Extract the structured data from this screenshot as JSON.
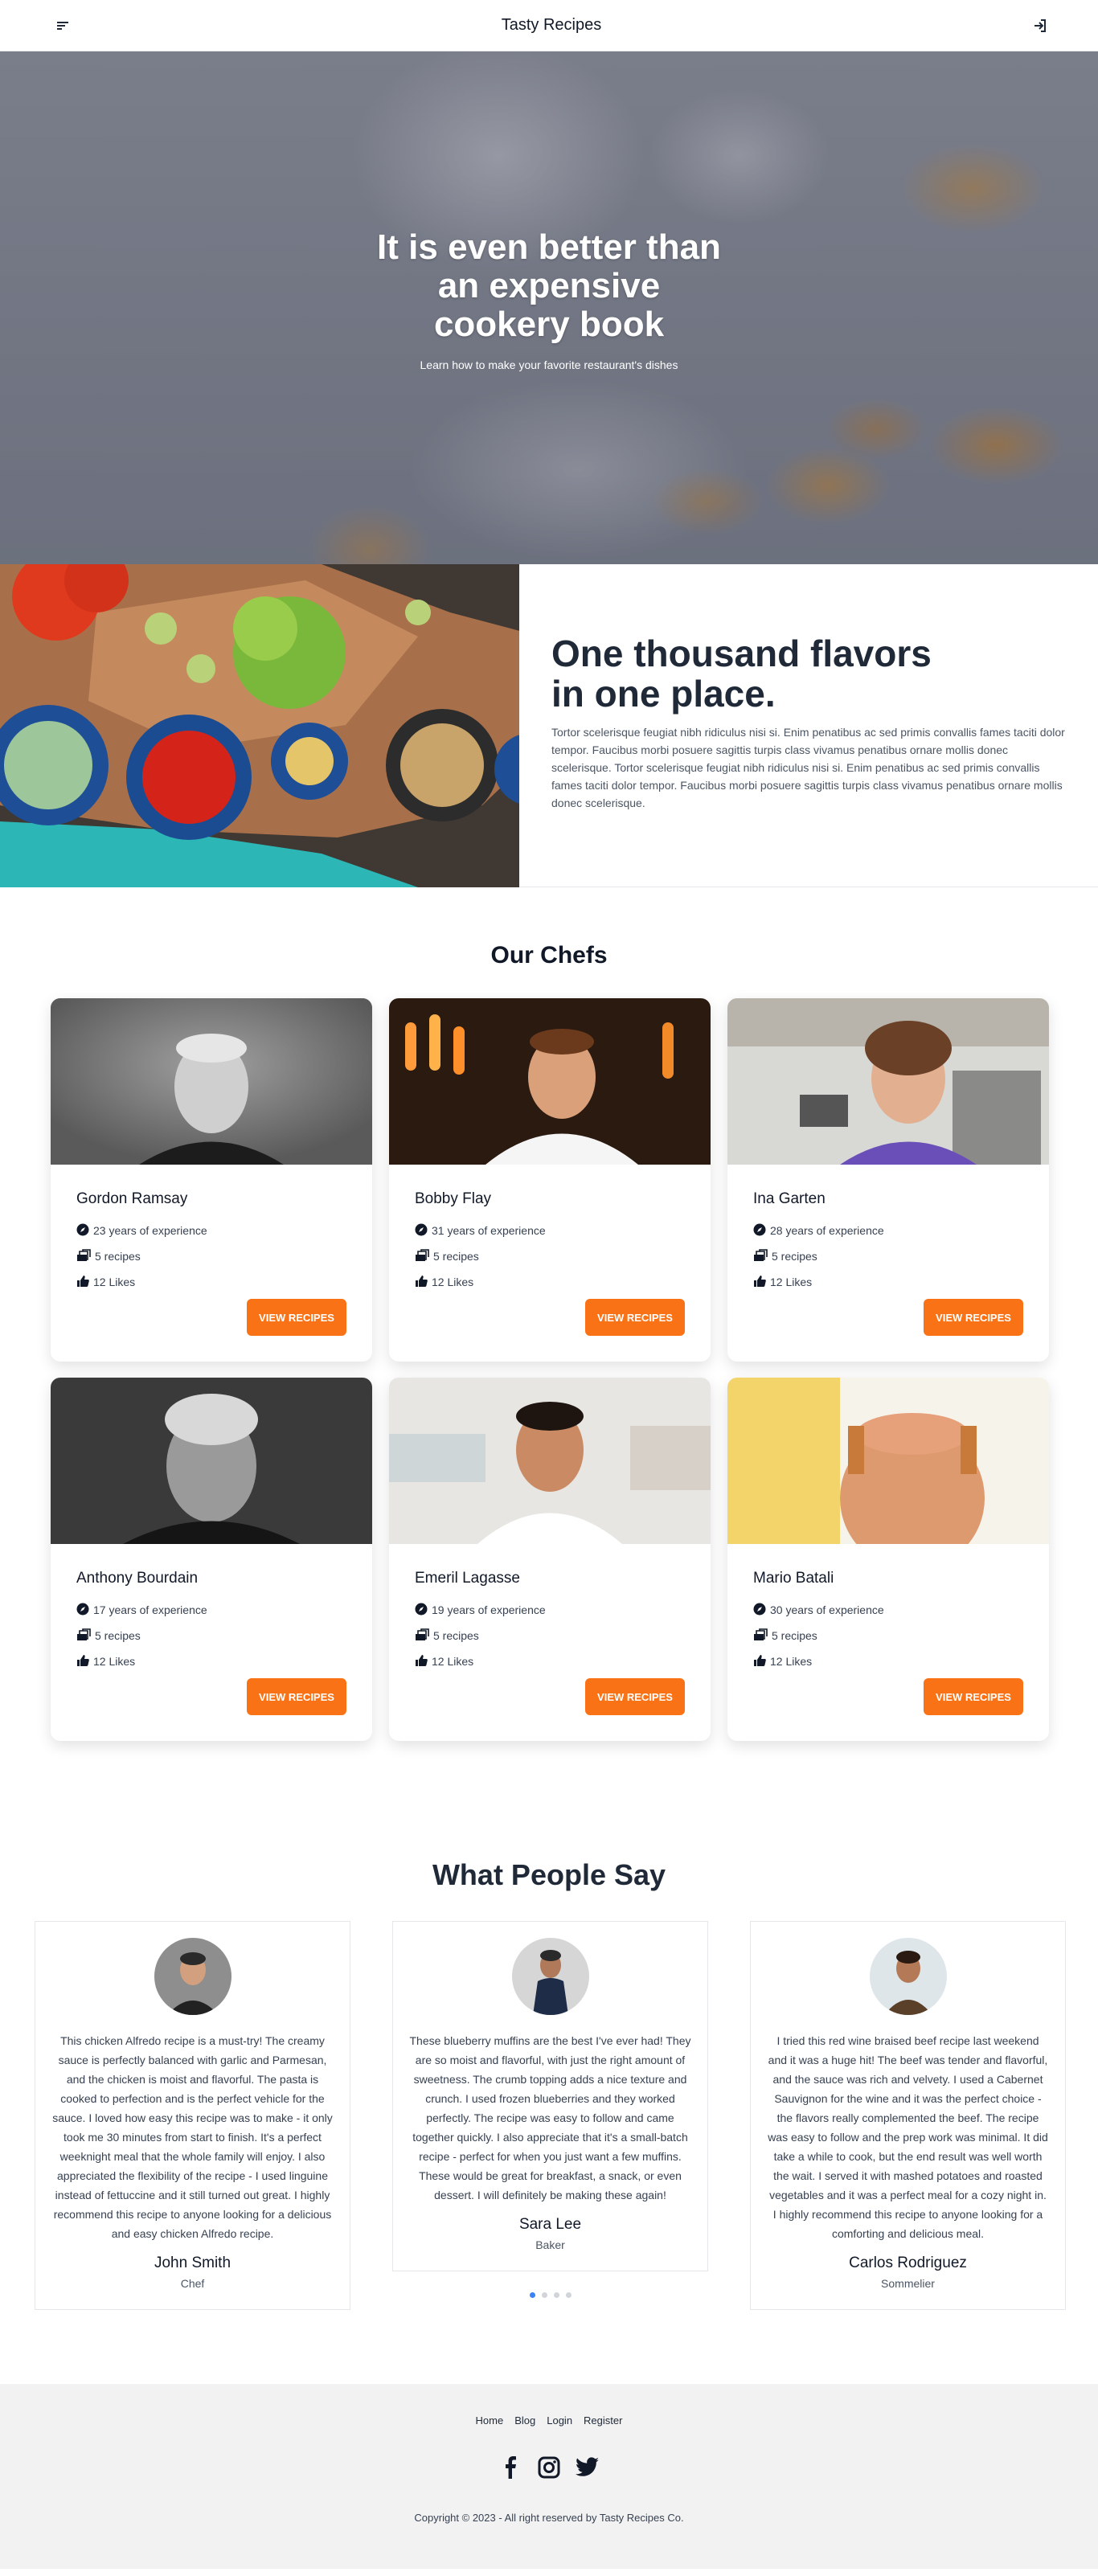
{
  "header": {
    "title": "Tasty Recipes",
    "menu_icon": "menu-icon",
    "login_icon": "sign-in-icon"
  },
  "hero": {
    "title": "It is even better than an expensive cookery book",
    "subtitle": "Learn how to make your favorite restaurant's dishes"
  },
  "flavors": {
    "title": "One thousand flavors in one place.",
    "body": "Tortor scelerisque feugiat nibh ridiculus nisi si. Enim penatibus ac sed primis convallis fames taciti dolor tempor. Faucibus morbi posuere sagittis turpis class vivamus penatibus ornare mollis donec scelerisque. Tortor scelerisque feugiat nibh ridiculus nisi si. Enim penatibus ac sed primis convallis fames taciti dolor tempor. Faucibus morbi posuere sagittis turpis class vivamus penatibus ornare mollis donec scelerisque."
  },
  "chefs": {
    "title": "Our Chefs",
    "button_label": "VIEW RECIPES",
    "items": [
      {
        "name": "Gordon Ramsay",
        "experience": "23 years of experience",
        "recipes": "5 recipes",
        "likes": "12 Likes"
      },
      {
        "name": "Bobby Flay",
        "experience": "31 years of experience",
        "recipes": "5 recipes",
        "likes": "12 Likes"
      },
      {
        "name": "Ina Garten",
        "experience": "28 years of experience",
        "recipes": "5 recipes",
        "likes": "12 Likes"
      },
      {
        "name": "Anthony Bourdain",
        "experience": "17 years of experience",
        "recipes": "5 recipes",
        "likes": "12 Likes"
      },
      {
        "name": "Emeril Lagasse",
        "experience": "19 years of experience",
        "recipes": "5 recipes",
        "likes": "12 Likes"
      },
      {
        "name": "Mario Batali",
        "experience": "30 years of experience",
        "recipes": "5 recipes",
        "likes": "12 Likes"
      }
    ]
  },
  "testimonials": {
    "title": "What People Say",
    "items": [
      {
        "text": "This chicken Alfredo recipe is a must-try! The creamy sauce is perfectly balanced with garlic and Parmesan, and the chicken is moist and flavorful. The pasta is cooked to perfection and is the perfect vehicle for the sauce. I loved how easy this recipe was to make - it only took me 30 minutes from start to finish. It's a perfect weeknight meal that the whole family will enjoy. I also appreciated the flexibility of the recipe - I used linguine instead of fettuccine and it still turned out great. I highly recommend this recipe to anyone looking for a delicious and easy chicken Alfredo recipe.",
        "name": "John Smith",
        "role": "Chef"
      },
      {
        "text": "These blueberry muffins are the best I've ever had! They are so moist and flavorful, with just the right amount of sweetness. The crumb topping adds a nice texture and crunch. I used frozen blueberries and they worked perfectly. The recipe was easy to follow and came together quickly. I also appreciate that it's a small-batch recipe - perfect for when you just want a few muffins. These would be great for breakfast, a snack, or even dessert. I will definitely be making these again!",
        "name": "Sara Lee",
        "role": "Baker"
      },
      {
        "text": "I tried this red wine braised beef recipe last weekend and it was a huge hit! The beef was tender and flavorful, and the sauce was rich and velvety. I used a Cabernet Sauvignon for the wine and it was the perfect choice - the flavors really complemented the beef. The recipe was easy to follow and the prep work was minimal. It did take a while to cook, but the end result was well worth the wait. I served it with mashed potatoes and roasted vegetables and it was a perfect meal for a cozy night in. I highly recommend this recipe to anyone looking for a comforting and delicious meal.",
        "name": "Carlos Rodriguez",
        "role": "Sommelier"
      }
    ],
    "dots": 4,
    "active_dot": 0
  },
  "footer": {
    "links": [
      "Home",
      "Blog",
      "Login",
      "Register"
    ],
    "social": [
      "facebook-icon",
      "instagram-icon",
      "twitter-icon"
    ],
    "copyright": "Copyright © 2023 - All right reserved by Tasty Recipes Co."
  },
  "colors": {
    "accent": "#f97316",
    "dot_active": "#3b82f6",
    "footer_bg": "#f2f2f2"
  }
}
